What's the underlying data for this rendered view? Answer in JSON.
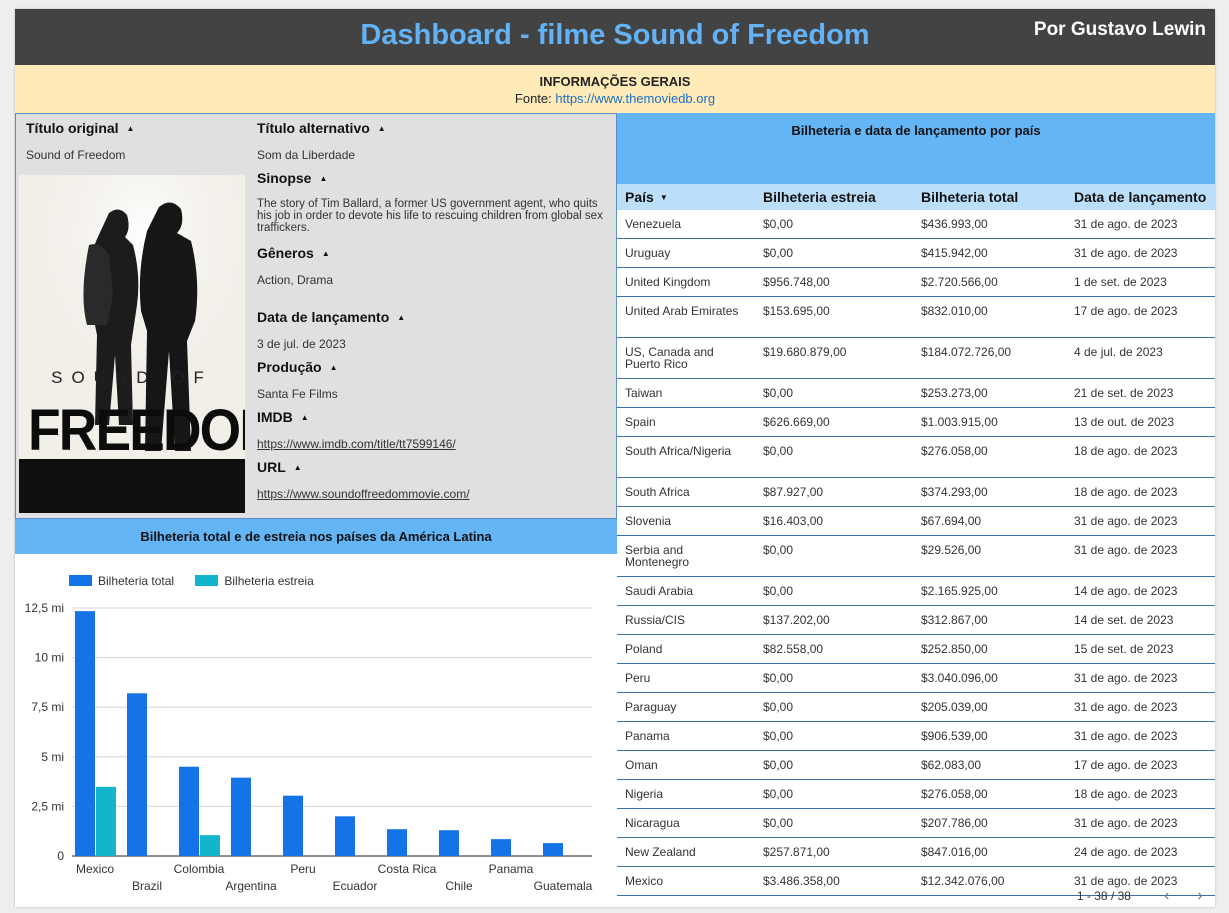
{
  "header": {
    "title": "Dashboard - filme Sound of Freedom",
    "author": "Por Gustavo Lewin"
  },
  "info": {
    "heading": "INFORMAÇÕES GERAIS",
    "source_prefix": "Fonte: ",
    "source_link": "https://www.themoviedb.org"
  },
  "details": {
    "original_title_label": "Título original",
    "original_title": "Sound of Freedom",
    "alt_title_label": "Título alternativo",
    "alt_title": "Som da Liberdade",
    "synopsis_label": "Sinopse",
    "synopsis": "The story of Tim Ballard, a former US government agent, who quits his job in order to devote his life to rescuing children from global sex traffickers.",
    "genres_label": "Gêneros",
    "genres": "Action, Drama",
    "release_label": "Data de lançamento",
    "release": "3 de jul. de 2023",
    "production_label": "Produção",
    "production": "Santa Fe Films",
    "imdb_label": "IMDB",
    "imdb": "https://www.imdb.com/title/tt7599146/",
    "url_label": "URL",
    "url": "https://www.soundoffreedommovie.com/",
    "poster_top_text": "SOUND OF",
    "poster_main_text": "FREEDOM"
  },
  "colors": {
    "header_bg": "#434343",
    "title_blue": "#63b2f5",
    "info_bg": "#ffeab8",
    "section_blue": "#64b5f6",
    "table_header_bg": "#bbdefb",
    "series_total": "#1473e6",
    "series_estreia": "#12b5cb"
  },
  "chart_title": "Bilheteria total e de estreia nos países da América Latina",
  "chart_data": {
    "type": "bar",
    "categories": [
      "Mexico",
      "Brazil",
      "Colombia",
      "Argentina",
      "Peru",
      "Ecuador",
      "Costa Rica",
      "Chile",
      "Panama",
      "Guatemala"
    ],
    "series": [
      {
        "name": "Bilheteria total",
        "values": [
          12342076,
          8200000,
          4500000,
          3950000,
          3040096,
          2000000,
          1350000,
          1300000,
          850000,
          650000
        ]
      },
      {
        "name": "Bilheteria estreia",
        "values": [
          3486358,
          0,
          1050000,
          0,
          0,
          0,
          0,
          0,
          0,
          0
        ]
      }
    ],
    "yticks": [
      "0",
      "2,5 mi",
      "5 mi",
      "7,5 mi",
      "10 mi",
      "12,5 mi"
    ],
    "ytick_values": [
      0,
      2500000,
      5000000,
      7500000,
      10000000,
      12500000
    ],
    "ylim": [
      0,
      12500000
    ],
    "legend_position": "top-left",
    "grid": true
  },
  "table": {
    "title": "Bilheteria e data de lançamento por país",
    "columns": [
      "País",
      "Bilheteria estreia",
      "Bilheteria total",
      "Data de lançamento"
    ],
    "rows": [
      [
        "Venezuela",
        "$0,00",
        "$436.993,00",
        "31 de ago. de 2023"
      ],
      [
        "Uruguay",
        "$0,00",
        "$415.942,00",
        "31 de ago. de 2023"
      ],
      [
        "United Kingdom",
        "$956.748,00",
        "$2.720.566,00",
        "1 de set. de 2023"
      ],
      [
        "United Arab Emirates",
        "$153.695,00",
        "$832.010,00",
        "17 de ago. de 2023"
      ],
      [
        "US, Canada and Puerto Rico",
        "$19.680.879,00",
        "$184.072.726,00",
        "4 de jul. de 2023"
      ],
      [
        "Taiwan",
        "$0,00",
        "$253.273,00",
        "21 de set. de 2023"
      ],
      [
        "Spain",
        "$626.669,00",
        "$1.003.915,00",
        "13 de out. de 2023"
      ],
      [
        "South Africa/Nigeria",
        "$0,00",
        "$276.058,00",
        "18 de ago. de 2023"
      ],
      [
        "South Africa",
        "$87.927,00",
        "$374.293,00",
        "18 de ago. de 2023"
      ],
      [
        "Slovenia",
        "$16.403,00",
        "$67.694,00",
        "31 de ago. de 2023"
      ],
      [
        "Serbia and Montenegro",
        "$0,00",
        "$29.526,00",
        "31 de ago. de 2023"
      ],
      [
        "Saudi Arabia",
        "$0,00",
        "$2.165.925,00",
        "14 de ago. de 2023"
      ],
      [
        "Russia/CIS",
        "$137.202,00",
        "$312.867,00",
        "14 de set. de 2023"
      ],
      [
        "Poland",
        "$82.558,00",
        "$252.850,00",
        "15 de set. de 2023"
      ],
      [
        "Peru",
        "$0,00",
        "$3.040.096,00",
        "31 de ago. de 2023"
      ],
      [
        "Paraguay",
        "$0,00",
        "$205.039,00",
        "31 de ago. de 2023"
      ],
      [
        "Panama",
        "$0,00",
        "$906.539,00",
        "31 de ago. de 2023"
      ],
      [
        "Oman",
        "$0,00",
        "$62.083,00",
        "17 de ago. de 2023"
      ],
      [
        "Nigeria",
        "$0,00",
        "$276.058,00",
        "18 de ago. de 2023"
      ],
      [
        "Nicaragua",
        "$0,00",
        "$207.786,00",
        "31 de ago. de 2023"
      ],
      [
        "New Zealand",
        "$257.871,00",
        "$847.016,00",
        "24 de ago. de 2023"
      ],
      [
        "Mexico",
        "$3.486.358,00",
        "$12.342.076,00",
        "31 de ago. de 2023"
      ]
    ],
    "pagination": "1 - 38 / 38",
    "prev_icon": "‹",
    "next_icon": "›"
  }
}
